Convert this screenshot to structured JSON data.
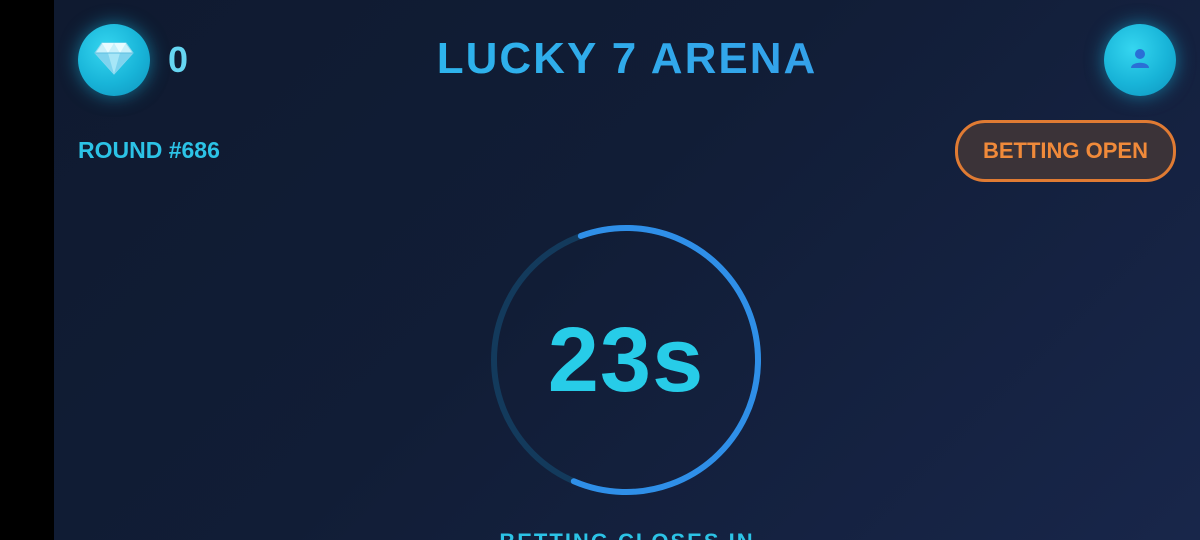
{
  "header": {
    "gem_icon": "diamond-icon",
    "gem_count": "0",
    "title": "LUCKY 7 ARENA",
    "profile_icon": "user-icon"
  },
  "round": {
    "label": "ROUND #686"
  },
  "status": {
    "label": "BETTING OPEN",
    "color": "#f08a3a"
  },
  "timer": {
    "text": "23s",
    "seconds_remaining": 23,
    "progress_fraction": 0.62,
    "track_color": "#133a5c",
    "arc_color": "#2f8fe8"
  },
  "footer": {
    "closes_label": "BETTING CLOSES IN"
  },
  "colors": {
    "accent_cyan": "#27cce8",
    "accent_blue": "#3a8fe8",
    "background": "#111d36"
  }
}
